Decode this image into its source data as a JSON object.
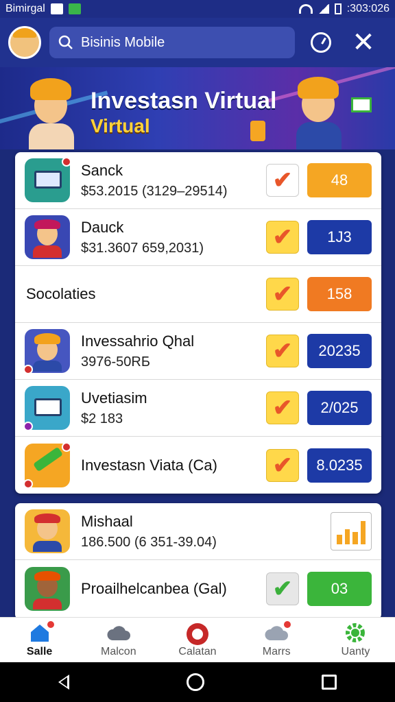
{
  "status_bar": {
    "carrier": "Bimirgal",
    "time": ":303:026"
  },
  "search": {
    "placeholder": "Bisinis Mobile",
    "value": ""
  },
  "banner": {
    "title": "Investasn Virtual",
    "subtitle": "Virtual"
  },
  "list_main": [
    {
      "title": "Sanck",
      "subtitle": "$53.2015 (3129–29514)",
      "check_style": "white",
      "value": "48",
      "value_color": "#f5a623"
    },
    {
      "title": "Dauck",
      "subtitle": "$31.3607 659,2031)",
      "check_style": "yellow",
      "value": "1J3",
      "value_color": "#1d3aa6"
    },
    {
      "title": "Socolaties",
      "subtitle": "",
      "check_style": "yellow",
      "value": "158",
      "value_color": "#f07a22"
    },
    {
      "title": "Invessahrio Qhal",
      "subtitle": "3976-50RБ",
      "check_style": "yellow",
      "value": "20235",
      "value_color": "#1d3aa6"
    },
    {
      "title": "Uvetiasim",
      "subtitle": "$2 183",
      "check_style": "yellow",
      "value": "2/025",
      "value_color": "#1d3aa6"
    },
    {
      "title": "Investasn Viata (Ca)",
      "subtitle": "",
      "check_style": "yellow",
      "value": "8.0235",
      "value_color": "#1d3aa6"
    }
  ],
  "list_secondary": [
    {
      "title": "Mishaal",
      "subtitle": "186.500 (6 351-39.04)"
    },
    {
      "title": "Proailhelcanbea (Gal)",
      "subtitle": "",
      "check_style": "grey",
      "value": "03",
      "value_color": "#3bb53b"
    }
  ],
  "bottom_nav": [
    {
      "label": "Salle",
      "icon": "home-icon",
      "active": true
    },
    {
      "label": "Malcon",
      "icon": "cloud-icon",
      "active": false
    },
    {
      "label": "Calatan",
      "icon": "mascot-icon",
      "active": false
    },
    {
      "label": "Marrs",
      "icon": "cloud-alert-icon",
      "active": false
    },
    {
      "label": "Uanty",
      "icon": "gear-icon",
      "active": false
    }
  ],
  "colors": {
    "appbar": "#21328f",
    "accent_orange": "#f5a623",
    "accent_blue": "#1d3aa6",
    "accent_green": "#3bb53b"
  }
}
